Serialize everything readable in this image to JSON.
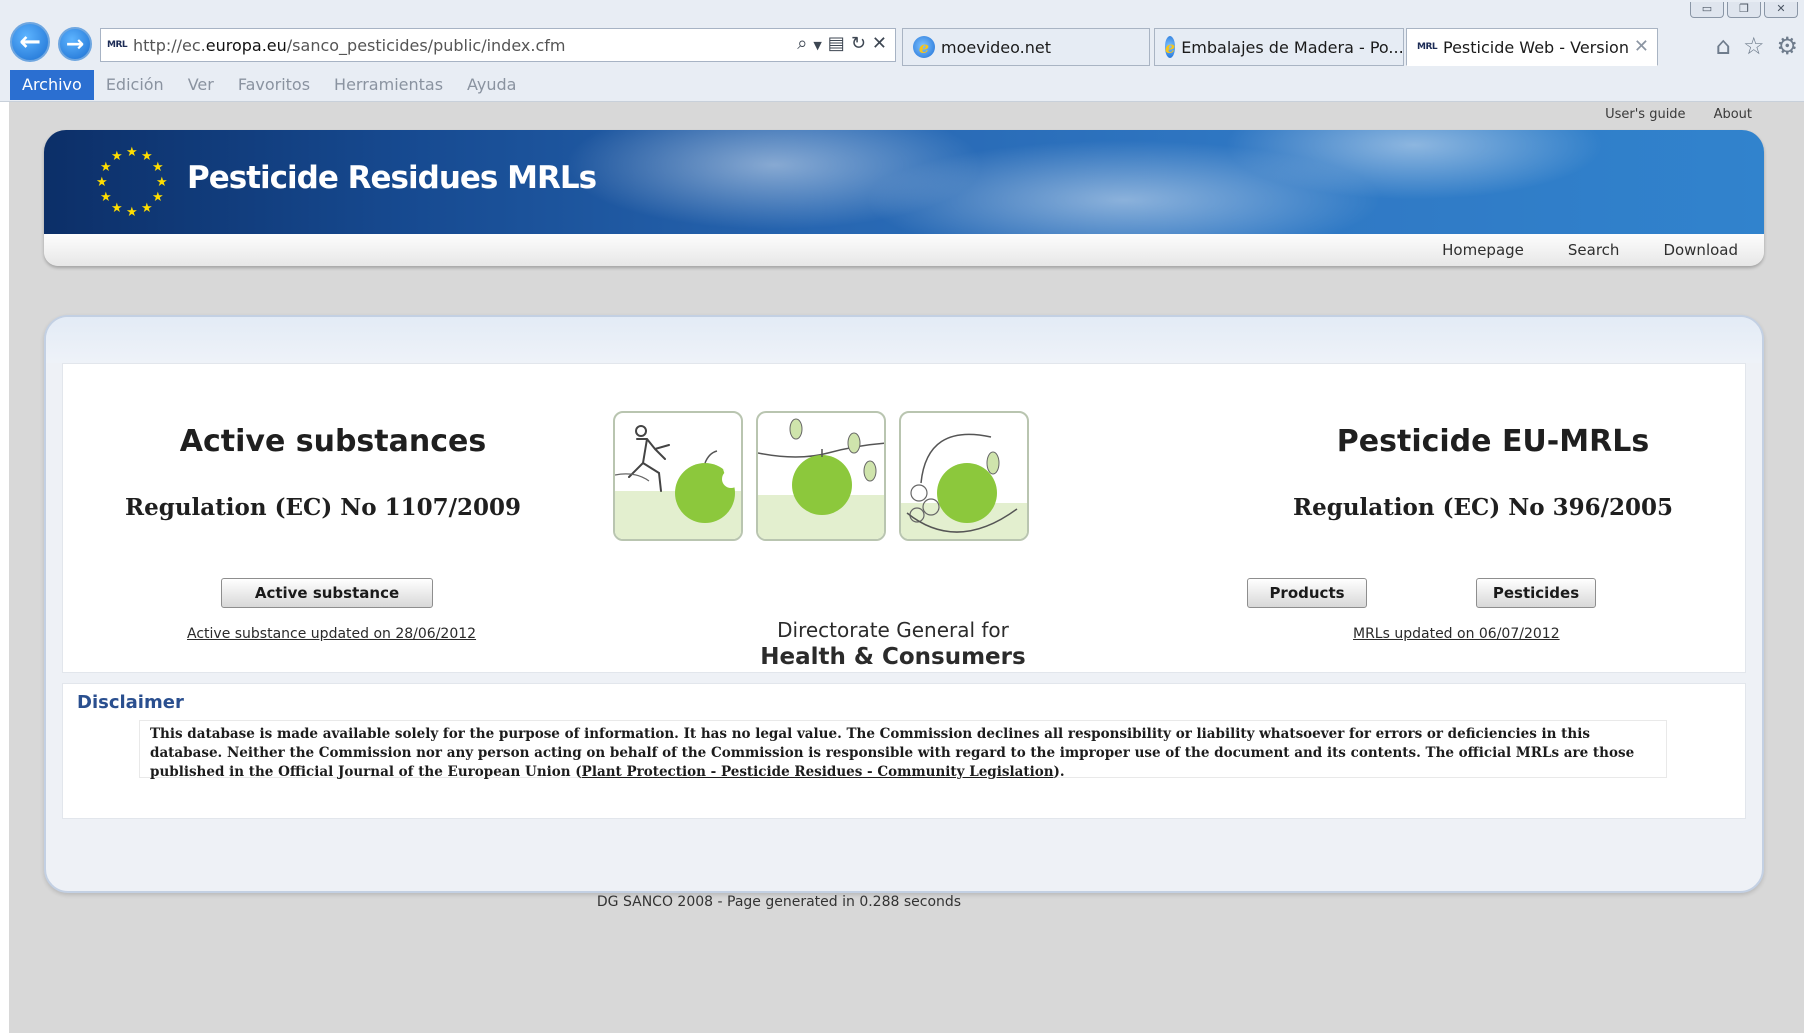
{
  "browser": {
    "url_prefix": "http://ec.",
    "url_domain": "europa.eu",
    "url_path": "/sanco_pesticides/public/index.cfm",
    "favicon_label": "MRL",
    "tabs": [
      {
        "label": "moevideo.net",
        "icon": "ie-icon"
      },
      {
        "label": "Embalajes de Madera - Po...",
        "icon": "ie-icon"
      },
      {
        "label": "Pesticide Web - Version",
        "icon": "mrl-favicon",
        "active": true
      }
    ],
    "menu": [
      "Archivo",
      "Edición",
      "Ver",
      "Favoritos",
      "Herramientas",
      "Ayuda"
    ],
    "icons": [
      "back-icon",
      "forward-icon",
      "search-icon",
      "refresh-icon",
      "stop-icon",
      "home-icon",
      "favorites-star-icon",
      "settings-gear-icon"
    ]
  },
  "utility_links": {
    "users_guide": "User's guide",
    "about": "About"
  },
  "header": {
    "title": "Pesticide Residues MRLs",
    "nav": {
      "homepage": "Homepage",
      "search": "Search",
      "download": "Download"
    }
  },
  "left": {
    "heading": "Active substances",
    "regulation": "Regulation (EC) No 1107/2009",
    "button": "Active substance",
    "updated": "Active substance updated on 28/06/2012"
  },
  "right": {
    "heading": "Pesticide EU-MRLs",
    "regulation": "Regulation (EC) No 396/2005",
    "button_products": "Products",
    "button_pesticides": "Pesticides",
    "updated": "MRLs updated on 06/07/2012"
  },
  "center": {
    "dg_line1": "Directorate General for",
    "dg_line2": "Health & Consumers"
  },
  "disclaimer": {
    "title": "Disclaimer",
    "text": "This database is made available solely for the purpose of information. It has no legal value. The Commission declines all responsibility or liability whatsoever for errors or deficiencies in this database. Neither the Commission nor any person acting on behalf of the Commission is responsible with regard to the improper use of the document and its contents. The official MRLs are those published in the Official Journal of the European Union (",
    "link": "Plant Protection - Pesticide Residues - Community Legislation",
    "text_end": ")."
  },
  "footer": "DG SANCO 2008 - Page generated in 0.288 seconds",
  "colors": {
    "banner_dark": "#0c2f68",
    "banner_light": "#3183cd",
    "apple_green": "#8cc83c",
    "menu_active": "#2b6fd1"
  }
}
